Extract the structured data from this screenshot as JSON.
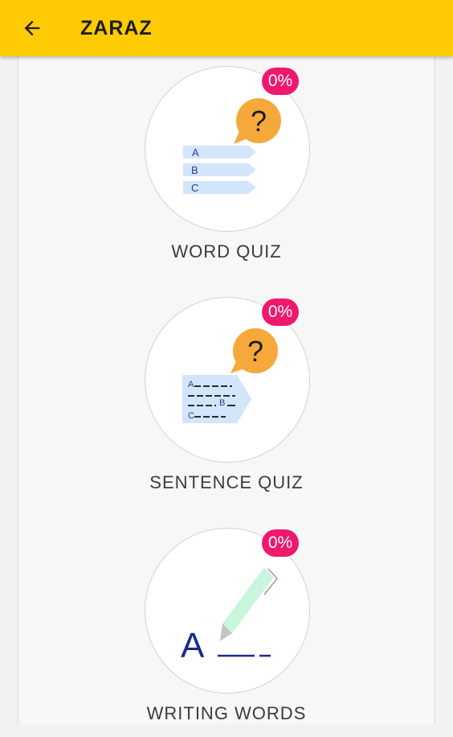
{
  "appbar": {
    "title": "ZARAZ",
    "accent": "#fecb05"
  },
  "items": [
    {
      "label": "WORD QUIZ",
      "progress": "0%",
      "progress_value": 0,
      "icon": "word-quiz-icon"
    },
    {
      "label": "SENTENCE QUIZ",
      "progress": "0%",
      "progress_value": 0,
      "icon": "sentence-quiz-icon"
    },
    {
      "label": "WRITING WORDS",
      "progress": "0%",
      "progress_value": 0,
      "icon": "writing-words-icon"
    }
  ],
  "word_quiz_icon": {
    "question_mark": "?",
    "options": [
      "A",
      "B",
      "C"
    ]
  },
  "sentence_quiz_icon": {
    "question_mark": "?",
    "letters": [
      "A",
      "B",
      "C"
    ]
  },
  "writing_icon": {
    "letter": "A"
  },
  "colors": {
    "badge": "#f0176e",
    "bubble": "#f6a93a",
    "option_fill": "#d2e5fb",
    "pen": "#c9f5dd",
    "ink": "#1d2a8c"
  }
}
